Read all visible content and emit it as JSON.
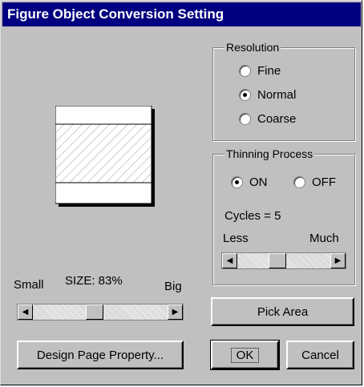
{
  "window": {
    "title": "Figure Object Conversion Setting"
  },
  "resolution": {
    "label": "Resolution",
    "options": [
      "Fine",
      "Normal",
      "Coarse"
    ],
    "selected": "Normal"
  },
  "thinning": {
    "label": "Thinning Process",
    "on_label": "ON",
    "off_label": "OFF",
    "selected": "ON",
    "cycles_text": "Cycles = 5",
    "less_label": "Less",
    "much_label": "Much"
  },
  "size": {
    "small_label": "Small",
    "size_text": "SIZE:  83%",
    "big_label": "Big"
  },
  "buttons": {
    "pick_area": "Pick Area",
    "design_page_property": "Design Page Property...",
    "ok": "OK",
    "cancel": "Cancel"
  },
  "icons": {
    "scroll_left": "◀",
    "scroll_right": "▶"
  }
}
